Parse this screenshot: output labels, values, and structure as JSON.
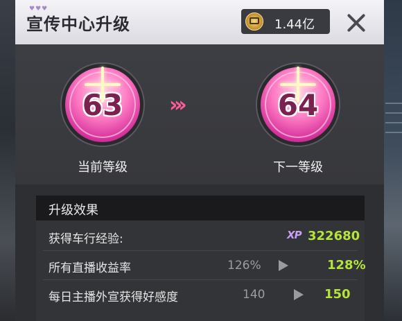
{
  "header": {
    "title": "宣传中心升级",
    "currency_amount": "1.44亿",
    "currency_icon": "coin-icon",
    "close_icon": "close-icon"
  },
  "levels": {
    "current": {
      "value": "63",
      "label": "当前等级"
    },
    "next": {
      "value": "64",
      "label": "下一等级"
    },
    "arrow_glyph": "»›"
  },
  "effects": {
    "title": "升级效果",
    "rows": [
      {
        "label": "获得车行经验:",
        "badge": "XP",
        "old": "",
        "new": "322680"
      },
      {
        "label": "所有直播收益率",
        "old": "126%",
        "new": "128%"
      },
      {
        "label": "每日主播外宣获得好感度",
        "old": "140",
        "new": "150"
      }
    ]
  },
  "colors": {
    "accent_pink": "#ff5a9a",
    "value_green": "#b6e53a",
    "xp_purple": "#c79ef0"
  }
}
